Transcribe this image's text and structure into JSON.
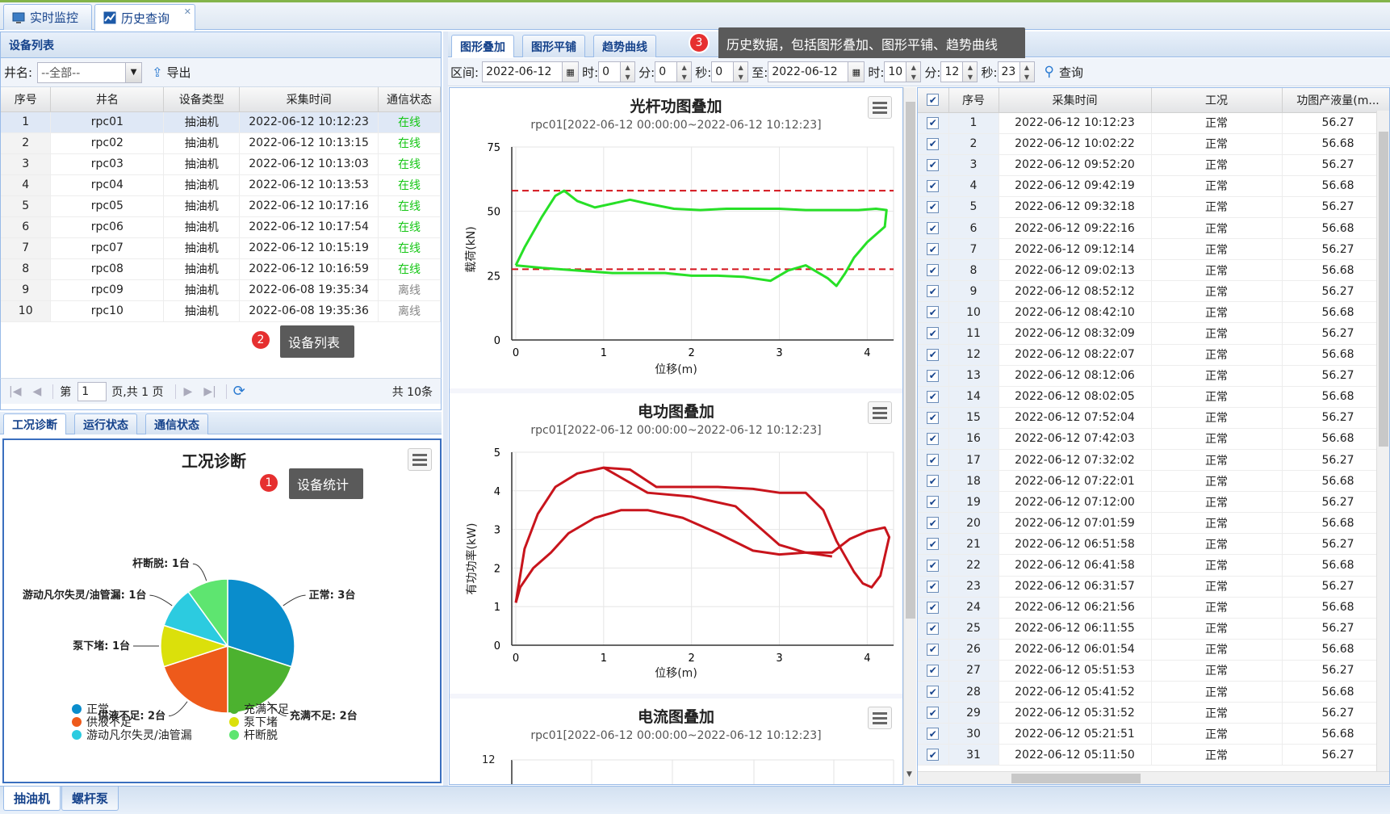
{
  "top_tabs": [
    {
      "label": "实时监控"
    },
    {
      "label": "历史查询"
    }
  ],
  "device_panel": {
    "title": "设备列表",
    "well_label": "井名:",
    "well_value": "--全部--",
    "export_label": "导出",
    "columns": [
      "序号",
      "井名",
      "设备类型",
      "采集时间",
      "通信状态"
    ],
    "rows": [
      {
        "no": "1",
        "name": "rpc01",
        "type": "抽油机",
        "time": "2022-06-12 10:12:23",
        "status": "在线"
      },
      {
        "no": "2",
        "name": "rpc02",
        "type": "抽油机",
        "time": "2022-06-12 10:13:15",
        "status": "在线"
      },
      {
        "no": "3",
        "name": "rpc03",
        "type": "抽油机",
        "time": "2022-06-12 10:13:03",
        "status": "在线"
      },
      {
        "no": "4",
        "name": "rpc04",
        "type": "抽油机",
        "time": "2022-06-12 10:13:53",
        "status": "在线"
      },
      {
        "no": "5",
        "name": "rpc05",
        "type": "抽油机",
        "time": "2022-06-12 10:17:16",
        "status": "在线"
      },
      {
        "no": "6",
        "name": "rpc06",
        "type": "抽油机",
        "time": "2022-06-12 10:17:54",
        "status": "在线"
      },
      {
        "no": "7",
        "name": "rpc07",
        "type": "抽油机",
        "time": "2022-06-12 10:15:19",
        "status": "在线"
      },
      {
        "no": "8",
        "name": "rpc08",
        "type": "抽油机",
        "time": "2022-06-12 10:16:59",
        "status": "在线"
      },
      {
        "no": "9",
        "name": "rpc09",
        "type": "抽油机",
        "time": "2022-06-08 19:35:34",
        "status": "离线"
      },
      {
        "no": "10",
        "name": "rpc10",
        "type": "抽油机",
        "time": "2022-06-08 19:35:36",
        "status": "离线"
      }
    ],
    "pager": {
      "page_prefix": "第",
      "page_value": "1",
      "page_suffix": "页,共 1 页",
      "total": "共 10条"
    }
  },
  "callouts": {
    "c1": {
      "num": "1",
      "text": "设备统计"
    },
    "c2": {
      "num": "2",
      "text": "设备列表"
    },
    "c3": {
      "num": "3",
      "text": "历史数据，包括图形叠加、图形平铺、趋势曲线"
    }
  },
  "stats_tabs": [
    {
      "label": "工况诊断"
    },
    {
      "label": "运行状态"
    },
    {
      "label": "通信状态"
    }
  ],
  "pie": {
    "title": "工况诊断",
    "slices": [
      {
        "name": "正常",
        "value": 3,
        "color": "#0a8dcc",
        "label": "正常: 3台"
      },
      {
        "name": "充满不足",
        "value": 2,
        "color": "#4cb22f",
        "label": "充满不足: 2台"
      },
      {
        "name": "供液不足",
        "value": 2,
        "color": "#ee5a1b",
        "label": "供液不足: 2台"
      },
      {
        "name": "泵下堵",
        "value": 1,
        "color": "#dbe00b",
        "label": "泵下堵: 1台"
      },
      {
        "name": "游动凡尔失灵/油管漏",
        "value": 1,
        "color": "#2ccbe0",
        "label": "游动凡尔失灵/油管漏: 1台"
      },
      {
        "name": "杆断脱",
        "value": 1,
        "color": "#5ee570",
        "label": "杆断脱: 1台"
      }
    ]
  },
  "history_tabs": [
    {
      "label": "图形叠加"
    },
    {
      "label": "图形平铺"
    },
    {
      "label": "趋势曲线"
    }
  ],
  "query": {
    "range_label": "区间:",
    "start_date": "2022-06-12",
    "h_label": "时:",
    "start_h": "0",
    "m_label": "分:",
    "start_m": "0",
    "s_label": "秒:",
    "start_s": "0",
    "to_label": "至:",
    "end_date": "2022-06-12",
    "end_h": "10",
    "end_m": "12",
    "end_s": "23",
    "query_label": "查询"
  },
  "charts": {
    "dynamometer": {
      "title": "光杆功图叠加",
      "subtitle": "rpc01[2022-06-12 00:00:00~2022-06-12 10:12:23]",
      "xlabel": "位移(m)",
      "ylabel": "载荷(kN)",
      "ylim": [
        0,
        75
      ],
      "yticks": [
        "0",
        "25",
        "50",
        "75"
      ],
      "xticks": [
        "0",
        "1",
        "2",
        "3",
        "4"
      ],
      "upper_limit": 58,
      "lower_limit": 27.5
    },
    "power": {
      "title": "电功图叠加",
      "subtitle": "rpc01[2022-06-12 00:00:00~2022-06-12 10:12:23]",
      "xlabel": "位移(m)",
      "ylabel": "有功功率(kW)",
      "ylim": [
        0,
        5
      ],
      "yticks": [
        "0",
        "1",
        "2",
        "3",
        "4",
        "5"
      ],
      "xticks": [
        "0",
        "1",
        "2",
        "3",
        "4"
      ]
    },
    "current": {
      "title": "电流图叠加",
      "subtitle": "rpc01[2022-06-12 00:00:00~2022-06-12 10:12:23]",
      "ytick": "12"
    }
  },
  "history_grid": {
    "columns": [
      "序号",
      "采集时间",
      "工况",
      "功图产液量(m..."
    ],
    "rows": [
      [
        "1",
        "2022-06-12 10:12:23",
        "正常",
        "56.27"
      ],
      [
        "2",
        "2022-06-12 10:02:22",
        "正常",
        "56.68"
      ],
      [
        "3",
        "2022-06-12 09:52:20",
        "正常",
        "56.27"
      ],
      [
        "4",
        "2022-06-12 09:42:19",
        "正常",
        "56.68"
      ],
      [
        "5",
        "2022-06-12 09:32:18",
        "正常",
        "56.27"
      ],
      [
        "6",
        "2022-06-12 09:22:16",
        "正常",
        "56.68"
      ],
      [
        "7",
        "2022-06-12 09:12:14",
        "正常",
        "56.27"
      ],
      [
        "8",
        "2022-06-12 09:02:13",
        "正常",
        "56.68"
      ],
      [
        "9",
        "2022-06-12 08:52:12",
        "正常",
        "56.27"
      ],
      [
        "10",
        "2022-06-12 08:42:10",
        "正常",
        "56.68"
      ],
      [
        "11",
        "2022-06-12 08:32:09",
        "正常",
        "56.27"
      ],
      [
        "12",
        "2022-06-12 08:22:07",
        "正常",
        "56.68"
      ],
      [
        "13",
        "2022-06-12 08:12:06",
        "正常",
        "56.27"
      ],
      [
        "14",
        "2022-06-12 08:02:05",
        "正常",
        "56.68"
      ],
      [
        "15",
        "2022-06-12 07:52:04",
        "正常",
        "56.27"
      ],
      [
        "16",
        "2022-06-12 07:42:03",
        "正常",
        "56.68"
      ],
      [
        "17",
        "2022-06-12 07:32:02",
        "正常",
        "56.27"
      ],
      [
        "18",
        "2022-06-12 07:22:01",
        "正常",
        "56.68"
      ],
      [
        "19",
        "2022-06-12 07:12:00",
        "正常",
        "56.27"
      ],
      [
        "20",
        "2022-06-12 07:01:59",
        "正常",
        "56.68"
      ],
      [
        "21",
        "2022-06-12 06:51:58",
        "正常",
        "56.27"
      ],
      [
        "22",
        "2022-06-12 06:41:58",
        "正常",
        "56.68"
      ],
      [
        "23",
        "2022-06-12 06:31:57",
        "正常",
        "56.27"
      ],
      [
        "24",
        "2022-06-12 06:21:56",
        "正常",
        "56.68"
      ],
      [
        "25",
        "2022-06-12 06:11:55",
        "正常",
        "56.27"
      ],
      [
        "26",
        "2022-06-12 06:01:54",
        "正常",
        "56.68"
      ],
      [
        "27",
        "2022-06-12 05:51:53",
        "正常",
        "56.27"
      ],
      [
        "28",
        "2022-06-12 05:41:52",
        "正常",
        "56.68"
      ],
      [
        "29",
        "2022-06-12 05:31:52",
        "正常",
        "56.27"
      ],
      [
        "30",
        "2022-06-12 05:21:51",
        "正常",
        "56.68"
      ],
      [
        "31",
        "2022-06-12 05:11:50",
        "正常",
        "56.27"
      ]
    ]
  },
  "bottom_tabs": [
    {
      "label": "抽油机"
    },
    {
      "label": "螺杆泵"
    }
  ]
}
